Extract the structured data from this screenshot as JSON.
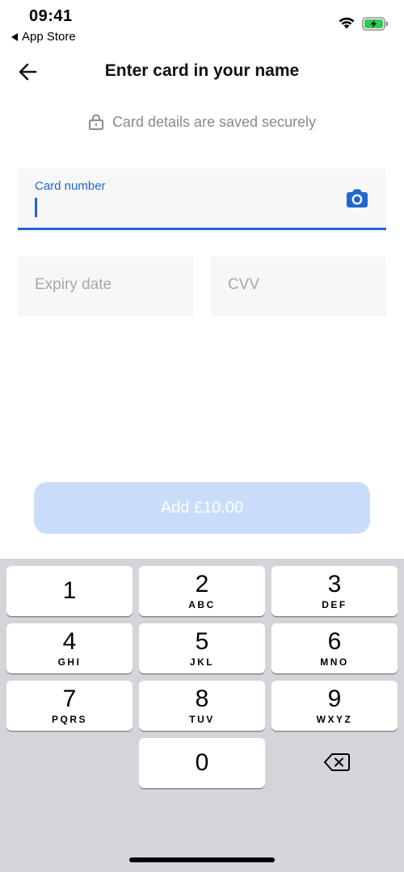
{
  "status_bar": {
    "time": "09:41",
    "back_app_label": "App Store",
    "icons": [
      "wifi-icon",
      "battery-charging-icon"
    ],
    "battery_color": "#34c759"
  },
  "header": {
    "title": "Enter card in your name",
    "back_icon": "arrow-left-icon"
  },
  "secure_note": {
    "icon": "lock-icon",
    "text": "Card details are saved securely"
  },
  "form": {
    "card_number": {
      "label": "Card number",
      "value": "",
      "scan_icon": "camera-icon"
    },
    "expiry": {
      "placeholder": "Expiry date",
      "value": ""
    },
    "cvv": {
      "placeholder": "CVV",
      "value": ""
    }
  },
  "add_button": {
    "label": "Add £10.00",
    "enabled": false
  },
  "keyboard": {
    "keys": [
      {
        "digit": "1",
        "letters": ""
      },
      {
        "digit": "2",
        "letters": "ABC"
      },
      {
        "digit": "3",
        "letters": "DEF"
      },
      {
        "digit": "4",
        "letters": "GHI"
      },
      {
        "digit": "5",
        "letters": "JKL"
      },
      {
        "digit": "6",
        "letters": "MNO"
      },
      {
        "digit": "7",
        "letters": "PQRS"
      },
      {
        "digit": "8",
        "letters": "TUV"
      },
      {
        "digit": "9",
        "letters": "WXYZ"
      },
      {
        "digit": "0",
        "letters": ""
      }
    ],
    "delete_icon": "backspace-icon"
  },
  "colors": {
    "accent": "#1f66d1",
    "button_disabled": "#c9ddfa",
    "keyboard_bg": "#d3d5db"
  }
}
